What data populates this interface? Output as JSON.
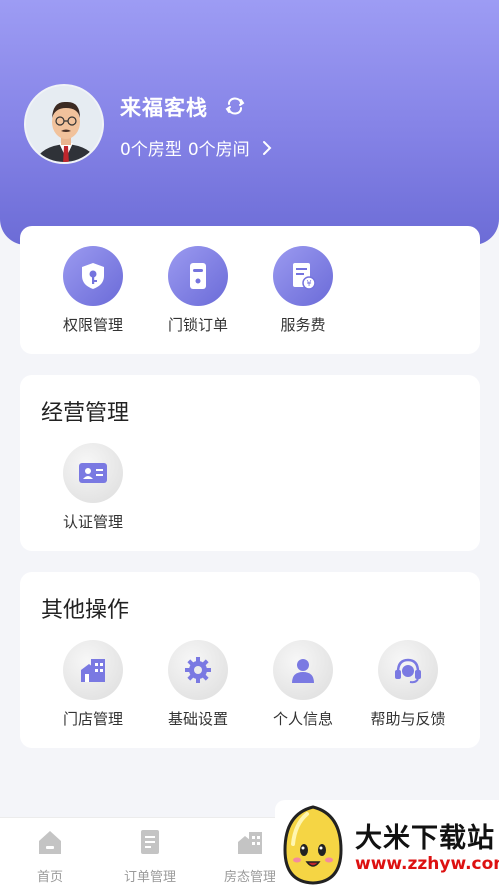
{
  "header": {
    "shop_name": "来福客栈",
    "room_types": "0个房型",
    "rooms": "0个房间"
  },
  "quick_actions": [
    {
      "label": "权限管理",
      "icon": "shield-key-icon"
    },
    {
      "label": "门锁订单",
      "icon": "door-lock-icon"
    },
    {
      "label": "服务费",
      "icon": "service-fee-icon"
    }
  ],
  "business": {
    "title": "经营管理",
    "items": [
      {
        "label": "认证管理",
        "icon": "id-card-icon"
      }
    ]
  },
  "other": {
    "title": "其他操作",
    "items": [
      {
        "label": "门店管理",
        "icon": "store-icon"
      },
      {
        "label": "基础设置",
        "icon": "gear-icon"
      },
      {
        "label": "个人信息",
        "icon": "person-icon"
      },
      {
        "label": "帮助与反馈",
        "icon": "headset-icon"
      }
    ]
  },
  "tabbar": [
    {
      "label": "首页",
      "icon": "home-icon"
    },
    {
      "label": "订单管理",
      "icon": "order-icon"
    },
    {
      "label": "房态管理",
      "icon": "room-status-icon"
    }
  ],
  "watermark": {
    "title": "大米下载站",
    "url": "www.zzhyw.com"
  },
  "colors": {
    "accent": "#7f7ee4",
    "accent_dark": "#6b6bd8",
    "background": "#f4f5f9"
  }
}
